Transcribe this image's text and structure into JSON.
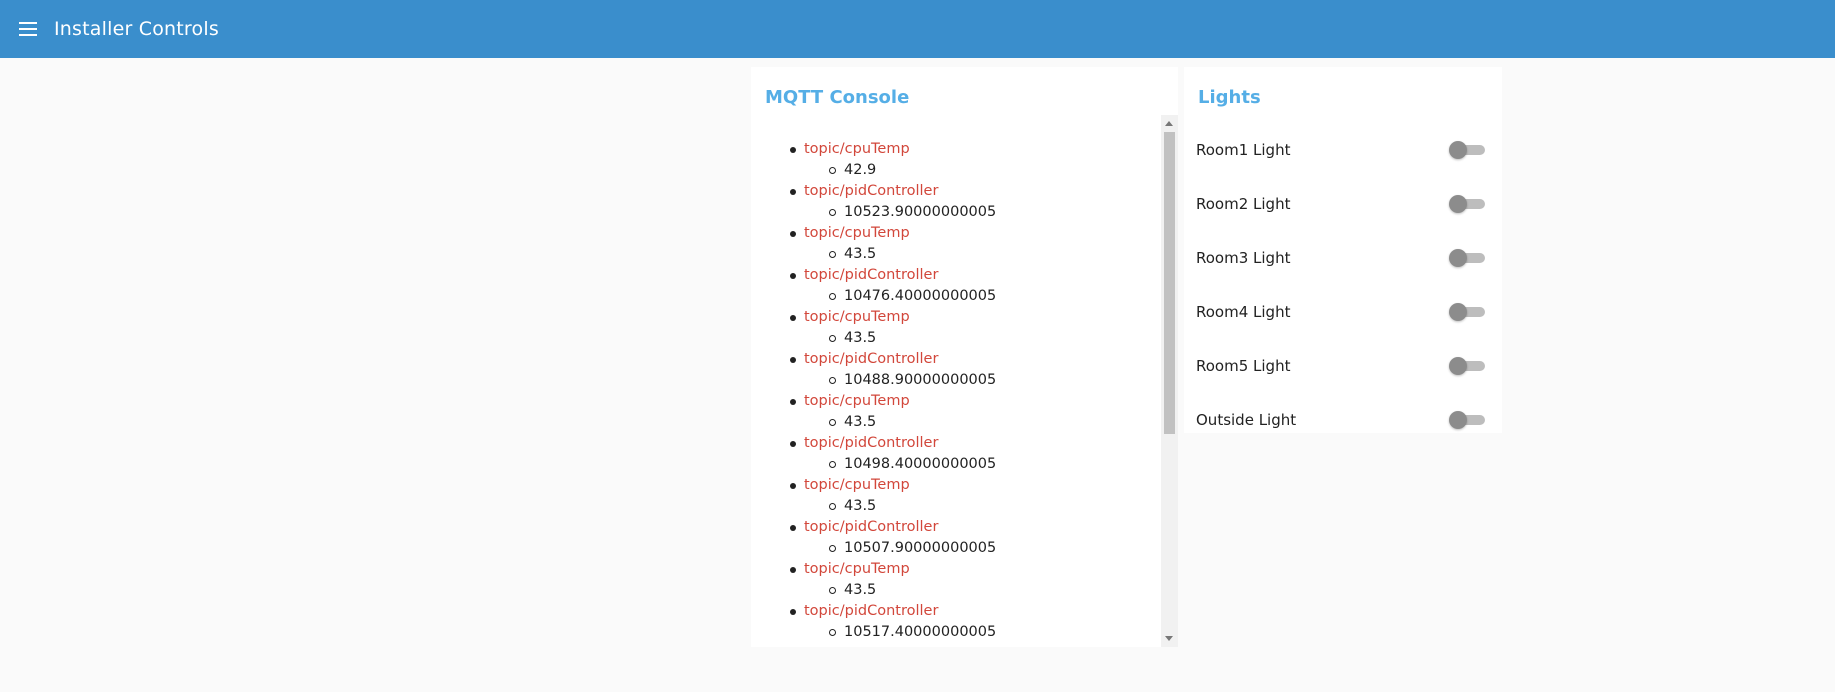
{
  "header": {
    "title": "Installer Controls",
    "menu_icon": "hamburger-menu-icon",
    "background_color": "#3a8ecc"
  },
  "console": {
    "title": "MQTT Console",
    "entries": [
      {
        "topic": "topic/cpuTemp",
        "value": "42.9"
      },
      {
        "topic": "topic/pidController",
        "value": "10523.90000000005"
      },
      {
        "topic": "topic/cpuTemp",
        "value": "43.5"
      },
      {
        "topic": "topic/pidController",
        "value": "10476.40000000005"
      },
      {
        "topic": "topic/cpuTemp",
        "value": "43.5"
      },
      {
        "topic": "topic/pidController",
        "value": "10488.90000000005"
      },
      {
        "topic": "topic/cpuTemp",
        "value": "43.5"
      },
      {
        "topic": "topic/pidController",
        "value": "10498.40000000005"
      },
      {
        "topic": "topic/cpuTemp",
        "value": "43.5"
      },
      {
        "topic": "topic/pidController",
        "value": "10507.90000000005"
      },
      {
        "topic": "topic/cpuTemp",
        "value": "43.5"
      },
      {
        "topic": "topic/pidController",
        "value": "10517.40000000005"
      }
    ],
    "topic_color": "#d2473b"
  },
  "lights": {
    "title": "Lights",
    "items": [
      {
        "label": "Room1 Light",
        "on": false
      },
      {
        "label": "Room2 Light",
        "on": false
      },
      {
        "label": "Room3 Light",
        "on": false
      },
      {
        "label": "Room4 Light",
        "on": false
      },
      {
        "label": "Room5 Light",
        "on": false
      },
      {
        "label": "Outside Light",
        "on": false
      }
    ]
  },
  "accent_color": "#55aee6"
}
